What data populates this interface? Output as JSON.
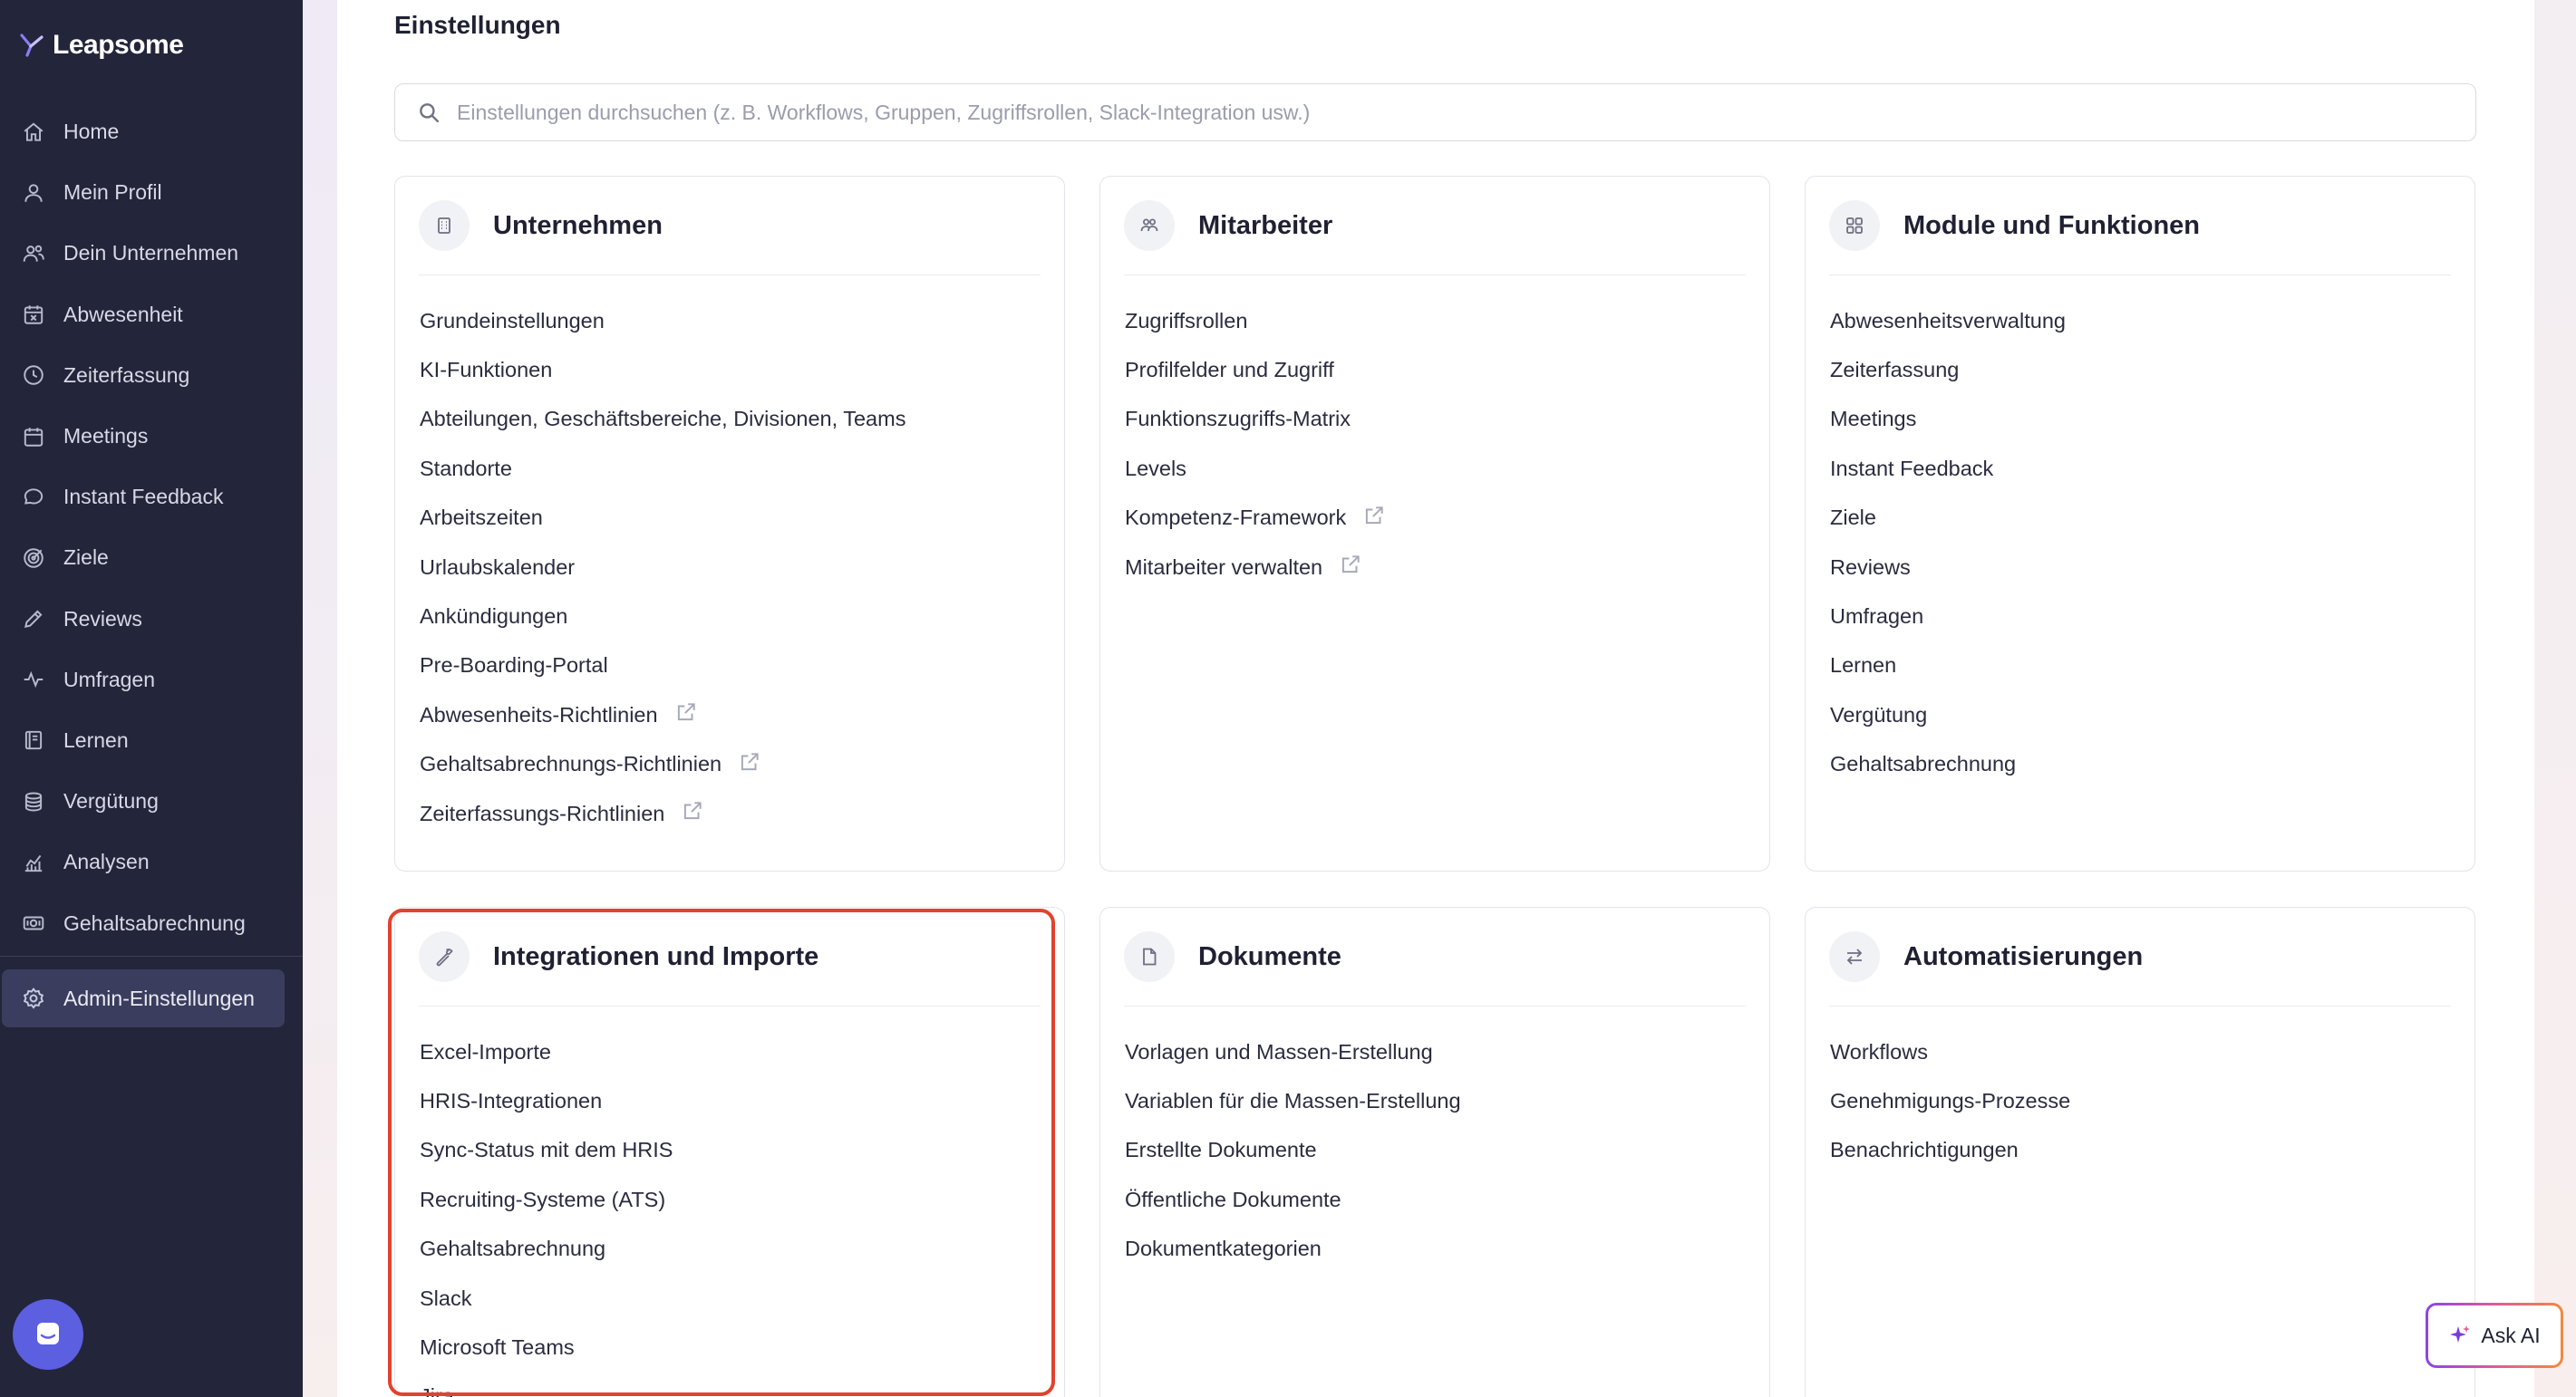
{
  "app": {
    "name": "Leapsome"
  },
  "sidebar": {
    "items": [
      {
        "label": "Home",
        "icon": "home-icon"
      },
      {
        "label": "Mein Profil",
        "icon": "user-icon"
      },
      {
        "label": "Dein Unternehmen",
        "icon": "users-icon"
      },
      {
        "label": "Abwesenheit",
        "icon": "calendar-x-icon"
      },
      {
        "label": "Zeiterfassung",
        "icon": "clock-icon"
      },
      {
        "label": "Meetings",
        "icon": "calendar-icon"
      },
      {
        "label": "Instant Feedback",
        "icon": "chat-icon"
      },
      {
        "label": "Ziele",
        "icon": "target-icon"
      },
      {
        "label": "Reviews",
        "icon": "pencil-icon"
      },
      {
        "label": "Umfragen",
        "icon": "pulse-icon"
      },
      {
        "label": "Lernen",
        "icon": "book-icon"
      },
      {
        "label": "Vergütung",
        "icon": "coins-icon"
      },
      {
        "label": "Analysen",
        "icon": "chart-icon"
      },
      {
        "label": "Gehaltsabrechnung",
        "icon": "money-icon"
      }
    ],
    "active": {
      "label": "Admin-Einstellungen",
      "icon": "gear-icon"
    }
  },
  "main": {
    "title": "Einstellungen",
    "search_placeholder": "Einstellungen durchsuchen (z. B. Workflows, Gruppen, Zugriffsrollen, Slack-Integration usw.)"
  },
  "cards": [
    {
      "title": "Unternehmen",
      "icon": "building-icon",
      "links": [
        {
          "label": "Grundeinstellungen",
          "external": false
        },
        {
          "label": "KI-Funktionen",
          "external": false
        },
        {
          "label": "Abteilungen, Geschäftsbereiche, Divisionen, Teams",
          "external": false
        },
        {
          "label": "Standorte",
          "external": false
        },
        {
          "label": "Arbeitszeiten",
          "external": false
        },
        {
          "label": "Urlaubskalender",
          "external": false
        },
        {
          "label": "Ankündigungen",
          "external": false
        },
        {
          "label": "Pre-Boarding-Portal",
          "external": false
        },
        {
          "label": "Abwesenheits-Richtlinien",
          "external": true
        },
        {
          "label": "Gehaltsabrechnungs-Richtlinien",
          "external": true
        },
        {
          "label": "Zeiterfassungs-Richtlinien",
          "external": true
        }
      ]
    },
    {
      "title": "Mitarbeiter",
      "icon": "people-icon",
      "links": [
        {
          "label": "Zugriffsrollen",
          "external": false
        },
        {
          "label": "Profilfelder und Zugriff",
          "external": false
        },
        {
          "label": "Funktionszugriffs-Matrix",
          "external": false
        },
        {
          "label": "Levels",
          "external": false
        },
        {
          "label": "Kompetenz-Framework",
          "external": true
        },
        {
          "label": "Mitarbeiter verwalten",
          "external": true
        }
      ]
    },
    {
      "title": "Module und Funktionen",
      "icon": "grid-icon",
      "links": [
        {
          "label": "Abwesenheitsverwaltung",
          "external": false
        },
        {
          "label": "Zeiterfassung",
          "external": false
        },
        {
          "label": "Meetings",
          "external": false
        },
        {
          "label": "Instant Feedback",
          "external": false
        },
        {
          "label": "Ziele",
          "external": false
        },
        {
          "label": "Reviews",
          "external": false
        },
        {
          "label": "Umfragen",
          "external": false
        },
        {
          "label": "Lernen",
          "external": false
        },
        {
          "label": "Vergütung",
          "external": false
        },
        {
          "label": "Gehaltsabrechnung",
          "external": false
        }
      ]
    },
    {
      "title": "Integrationen und Importe",
      "icon": "wrench-icon",
      "links": [
        {
          "label": "Excel-Importe",
          "external": false
        },
        {
          "label": "HRIS-Integrationen",
          "external": false
        },
        {
          "label": "Sync-Status mit dem HRIS",
          "external": false
        },
        {
          "label": "Recruiting-Systeme (ATS)",
          "external": false
        },
        {
          "label": "Gehaltsabrechnung",
          "external": false
        },
        {
          "label": "Slack",
          "external": false
        },
        {
          "label": "Microsoft Teams",
          "external": false
        },
        {
          "label": "Jira",
          "external": false
        }
      ]
    },
    {
      "title": "Dokumente",
      "icon": "document-icon",
      "links": [
        {
          "label": "Vorlagen und Massen-Erstellung",
          "external": false
        },
        {
          "label": "Variablen für die Massen-Erstellung",
          "external": false
        },
        {
          "label": "Erstellte Dokumente",
          "external": false
        },
        {
          "label": "Öffentliche Dokumente",
          "external": false
        },
        {
          "label": "Dokumentkategorien",
          "external": false
        }
      ]
    },
    {
      "title": "Automatisierungen",
      "icon": "arrows-icon",
      "links": [
        {
          "label": "Workflows",
          "external": false
        },
        {
          "label": "Genehmigungs-Prozesse",
          "external": false
        },
        {
          "label": "Benachrichtigungen",
          "external": false
        }
      ]
    }
  ],
  "ask_ai": {
    "label": "Ask AI",
    "icon": "sparkle-icon"
  },
  "colors": {
    "sidebar_bg": "#23253a",
    "highlight": "#e0432f",
    "accent": "#5b5fe0"
  }
}
